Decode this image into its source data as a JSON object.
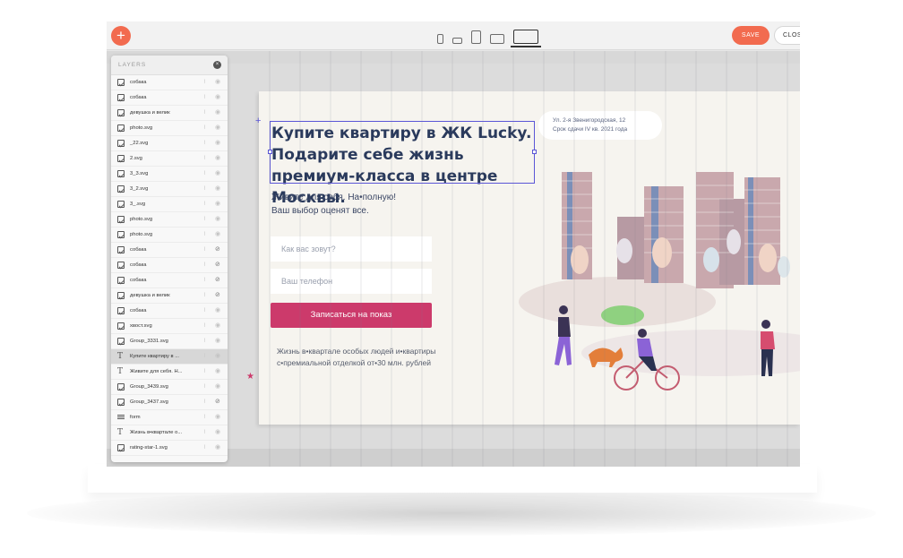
{
  "toolbar": {
    "add_label": "+",
    "save_label": "SAVE",
    "close_label": "CLOSE"
  },
  "layers": {
    "title": "LAYERS",
    "items": [
      {
        "label": "собака",
        "type": "img",
        "hidden": false
      },
      {
        "label": "собака",
        "type": "img",
        "hidden": false
      },
      {
        "label": "девушка и велик",
        "type": "img",
        "hidden": false
      },
      {
        "label": "photo.svg",
        "type": "img",
        "hidden": false
      },
      {
        "label": "_22.svg",
        "type": "img",
        "hidden": false
      },
      {
        "label": "2.svg",
        "type": "img",
        "hidden": false
      },
      {
        "label": "3_3.svg",
        "type": "img",
        "hidden": false
      },
      {
        "label": "3_2.svg",
        "type": "img",
        "hidden": false
      },
      {
        "label": "3_.svg",
        "type": "img",
        "hidden": false
      },
      {
        "label": "photo.svg",
        "type": "img",
        "hidden": false
      },
      {
        "label": "photo.svg",
        "type": "img",
        "hidden": false
      },
      {
        "label": "собака",
        "type": "img",
        "hidden": true
      },
      {
        "label": "собака",
        "type": "img",
        "hidden": true
      },
      {
        "label": "собака",
        "type": "img",
        "hidden": true
      },
      {
        "label": "девушка и велик",
        "type": "img",
        "hidden": true
      },
      {
        "label": "собака",
        "type": "img",
        "hidden": false
      },
      {
        "label": "хвост.svg",
        "type": "img",
        "hidden": false
      },
      {
        "label": "Group_3331.svg",
        "type": "img",
        "hidden": false
      },
      {
        "label": "Купите квартиру в ...",
        "type": "txt",
        "hidden": false,
        "active": true
      },
      {
        "label": "Живите для себя. Н...",
        "type": "txt",
        "hidden": false
      },
      {
        "label": "Group_3439.svg",
        "type": "img",
        "hidden": false
      },
      {
        "label": "Group_3437.svg",
        "type": "img",
        "hidden": true
      },
      {
        "label": "form",
        "type": "form",
        "hidden": false
      },
      {
        "label": "Жизнь в•квартале о...",
        "type": "txt",
        "hidden": false
      },
      {
        "label": "rating-star-1.svg",
        "type": "img",
        "hidden": false
      }
    ]
  },
  "page": {
    "headline": "Купите квартиру в ЖК Lucky. Подарите себе жизнь премиум-класса в центре Москвы.",
    "subtitle": "Живите для себя. На•полную!\nВаш выбор оценят все.",
    "name_placeholder": "Как вас зовут?",
    "phone_placeholder": "Ваш телефон",
    "submit_label": "Записаться на показ",
    "note": "Жизнь в•квартале особых людей и•квартиры\nс•премиальной отделкой от•30 млн. рублей",
    "address": "Ул. 2-я Звенигородская, 12\nСрок сдачи IV кв. 2021 года"
  },
  "colors": {
    "accent": "#f26b4f",
    "submit": "#cc3a6b",
    "headline": "#2a3a5c",
    "selection": "#5a55d6"
  }
}
